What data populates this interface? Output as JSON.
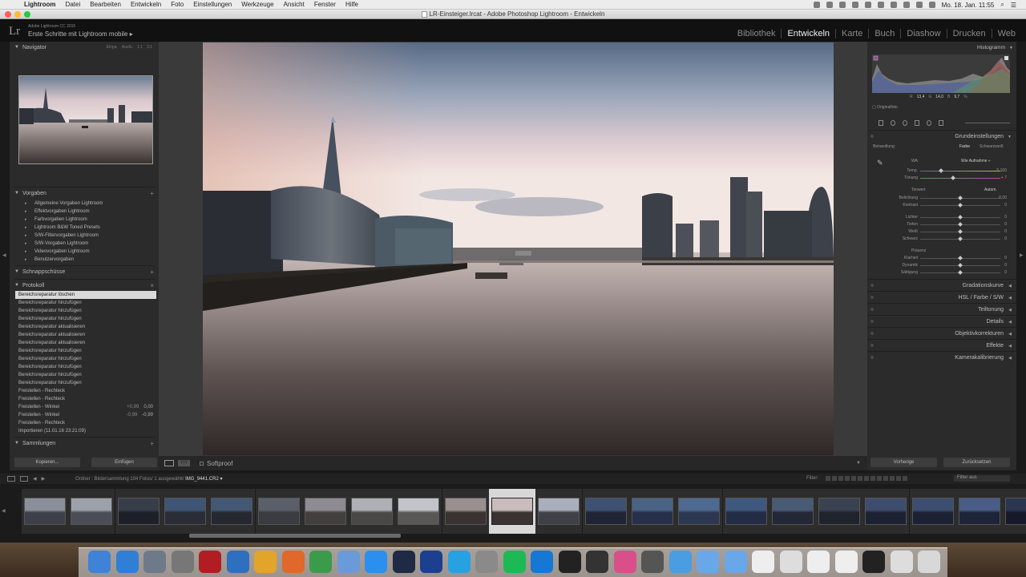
{
  "menubar": {
    "app_name": "Lightroom",
    "items": [
      "Datei",
      "Bearbeiten",
      "Entwickeln",
      "Foto",
      "Einstellungen",
      "Werkzeuge",
      "Ansicht",
      "Fenster",
      "Hilfe"
    ],
    "clock": "Mo. 18. Jan.  11:55"
  },
  "window": {
    "title": "LR-Einsteiger.lrcat - Adobe Photoshop Lightroom - Entwickeln"
  },
  "identity": {
    "logo": "Lr",
    "product": "Adobe Lightroom CC 2015",
    "subtitle": "Erste Schritte mit Lightroom mobile  ▸"
  },
  "modules": [
    "Bibliothek",
    "Entwickeln",
    "Karte",
    "Buch",
    "Diashow",
    "Drucken",
    "Web"
  ],
  "active_module": "Entwickeln",
  "left_panel": {
    "navigator": {
      "title": "Navigator",
      "zoom": [
        "Einpa.",
        "Ausfü.",
        "1:1",
        "3:1"
      ]
    },
    "presets": {
      "title": "Vorgaben",
      "items": [
        "Allgemeine Vorgaben Lightroom",
        "Effektvorgaben Lightroom",
        "Farbvorgaben Lightroom",
        "Lightroom B&W Toned Presets",
        "S/W-Filtervorgaben Lightroom",
        "S/W-Vorgaben Lightroom",
        "Videovorgaben Lightroom",
        "Benutzervorgaben"
      ]
    },
    "snapshots": {
      "title": "Schnappschüsse"
    },
    "history": {
      "title": "Protokoll",
      "clear": "×",
      "items": [
        {
          "label": "Bereichsreparatur löschen",
          "v1": "",
          "v2": ""
        },
        {
          "label": "Bereichsreparatur hinzufügen",
          "v1": "",
          "v2": ""
        },
        {
          "label": "Bereichsreparatur hinzufügen",
          "v1": "",
          "v2": ""
        },
        {
          "label": "Bereichsreparatur hinzufügen",
          "v1": "",
          "v2": ""
        },
        {
          "label": "Bereichsreparatur aktualisieren",
          "v1": "",
          "v2": ""
        },
        {
          "label": "Bereichsreparatur aktualisieren",
          "v1": "",
          "v2": ""
        },
        {
          "label": "Bereichsreparatur aktualisieren",
          "v1": "",
          "v2": ""
        },
        {
          "label": "Bereichsreparatur hinzufügen",
          "v1": "",
          "v2": ""
        },
        {
          "label": "Bereichsreparatur hinzufügen",
          "v1": "",
          "v2": ""
        },
        {
          "label": "Bereichsreparatur hinzufügen",
          "v1": "",
          "v2": ""
        },
        {
          "label": "Bereichsreparatur hinzufügen",
          "v1": "",
          "v2": ""
        },
        {
          "label": "Bereichsreparatur hinzufügen",
          "v1": "",
          "v2": ""
        },
        {
          "label": "Freistellen - Rechteck",
          "v1": "",
          "v2": ""
        },
        {
          "label": "Freistellen - Rechteck",
          "v1": "",
          "v2": ""
        },
        {
          "label": "Freistellen - Winkel",
          "v1": "+0,99",
          "v2": "0,00"
        },
        {
          "label": "Freistellen - Winkel",
          "v1": "-0,99",
          "v2": "-0,99"
        },
        {
          "label": "Freistellen - Rechteck",
          "v1": "",
          "v2": ""
        },
        {
          "label": "Importieren (11.01.16 23:21:09)",
          "v1": "",
          "v2": ""
        }
      ]
    },
    "collections": {
      "title": "Sammlungen"
    },
    "buttons": {
      "copy": "Kopieren...",
      "paste": "Einfügen"
    }
  },
  "toolbar": {
    "yy": "Y|Y",
    "softproof": "Softproof"
  },
  "right_panel": {
    "histogram": {
      "title": "Histogramm",
      "r_label": "R",
      "r": "13,4",
      "g_label": "G",
      "g": "14,0",
      "b_label": "B",
      "b": "9,7",
      "pct": "%"
    },
    "original_photo": "Originalfoto",
    "basic": {
      "title": "Grundeinstellungen",
      "treatment_label": "Behandlung:",
      "color": "Farbe",
      "bw": "Schwarzweiß",
      "wb_label": "WA:",
      "wb_value": "Wie Aufnahme ÷",
      "temp_label": "Temp.",
      "temp": "5.100",
      "tint_label": "Tönung",
      "tint": "+ 7",
      "tone_label": "Tonwert",
      "auto": "Autom.",
      "sliders": [
        {
          "label": "Belichtung",
          "value": "0,00",
          "pos": 0.5
        },
        {
          "label": "Kontrast",
          "value": "0",
          "pos": 0.5
        },
        {
          "label": "Lichter",
          "value": "0",
          "pos": 0.5
        },
        {
          "label": "Tiefen",
          "value": "0",
          "pos": 0.5
        },
        {
          "label": "Weiß",
          "value": "0",
          "pos": 0.5
        },
        {
          "label": "Schwarz",
          "value": "0",
          "pos": 0.5
        }
      ],
      "presence_label": "Präsenz",
      "presence": [
        {
          "label": "Klarheit",
          "value": "0",
          "pos": 0.5
        },
        {
          "label": "Dynamik",
          "value": "0",
          "pos": 0.5
        },
        {
          "label": "Sättigung",
          "value": "0",
          "pos": 0.5
        }
      ]
    },
    "sections": [
      {
        "title": "Gradationskurve"
      },
      {
        "title": "HSL  /  Farbe  /  S/W"
      },
      {
        "title": "Teiltonung"
      },
      {
        "title": "Details"
      },
      {
        "title": "Objektivkorrekturen"
      },
      {
        "title": "Effekte"
      },
      {
        "title": "Kamerakalibrierung"
      }
    ],
    "buttons": {
      "previous": "Vorherige",
      "reset": "Zurücksetzen"
    }
  },
  "filmstrip": {
    "source": "Ordner : Bildersammlung",
    "count": "104 Fotos/ 1 ausgewählt/",
    "file": "IMG_9441.CR2 ▾",
    "filter_label": "Filter:",
    "filter_value": "Filter aus",
    "selected_index": 10,
    "thumbnails": 22
  },
  "colors": {
    "panel_bg": "#2b2b2b",
    "selection": "#d9d9d9",
    "accent_close": "#fc5f57"
  }
}
